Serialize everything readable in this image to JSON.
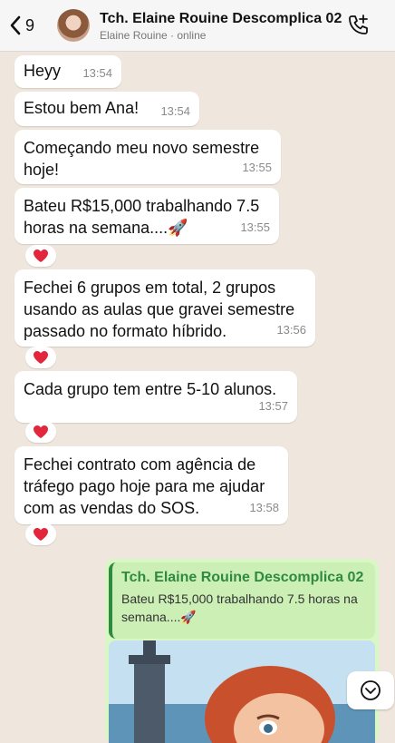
{
  "header": {
    "back_count": "9",
    "title": "Tch. Elaine Rouine Descomplica 02",
    "subtitle": "Elaine Rouine · online"
  },
  "messages": [
    {
      "text": "Heyy",
      "time": "13:54"
    },
    {
      "text": "Estou bem Ana!",
      "time": "13:54"
    },
    {
      "text": "Começando meu novo semestre hoje!",
      "time": "13:55"
    },
    {
      "text": "Bateu R$15,000 trabalhando 7.5 horas na semana....🚀",
      "time": "13:55"
    },
    {
      "text": "Fechei 6 grupos em total, 2 grupos usando as aulas que gravei semestre passado no formato híbrido.",
      "time": "13:56"
    },
    {
      "text": "Cada grupo tem entre 5-10 alunos.",
      "time": "13:57"
    },
    {
      "text": "Fechei contrato com agência de tráfego pago hoje para me ajudar com as vendas do SOS.",
      "time": "13:58"
    }
  ],
  "reply": {
    "quoted_name": "Tch. Elaine Rouine Descomplica 02",
    "quoted_text": "Bateu R$15,000 trabalhando 7.5 horas na semana....🚀"
  },
  "icons": {
    "back": "chevron-left-icon",
    "call": "phone-plus-icon",
    "reaction": "heart-icon",
    "scroll": "chevron-down-icon"
  },
  "colors": {
    "chat_bg": "#efe7dd",
    "incoming_bubble": "#ffffff",
    "outgoing_bubble": "#d8f7c4",
    "quote_accent": "#2f8a3f",
    "heart": "#e3263b"
  }
}
